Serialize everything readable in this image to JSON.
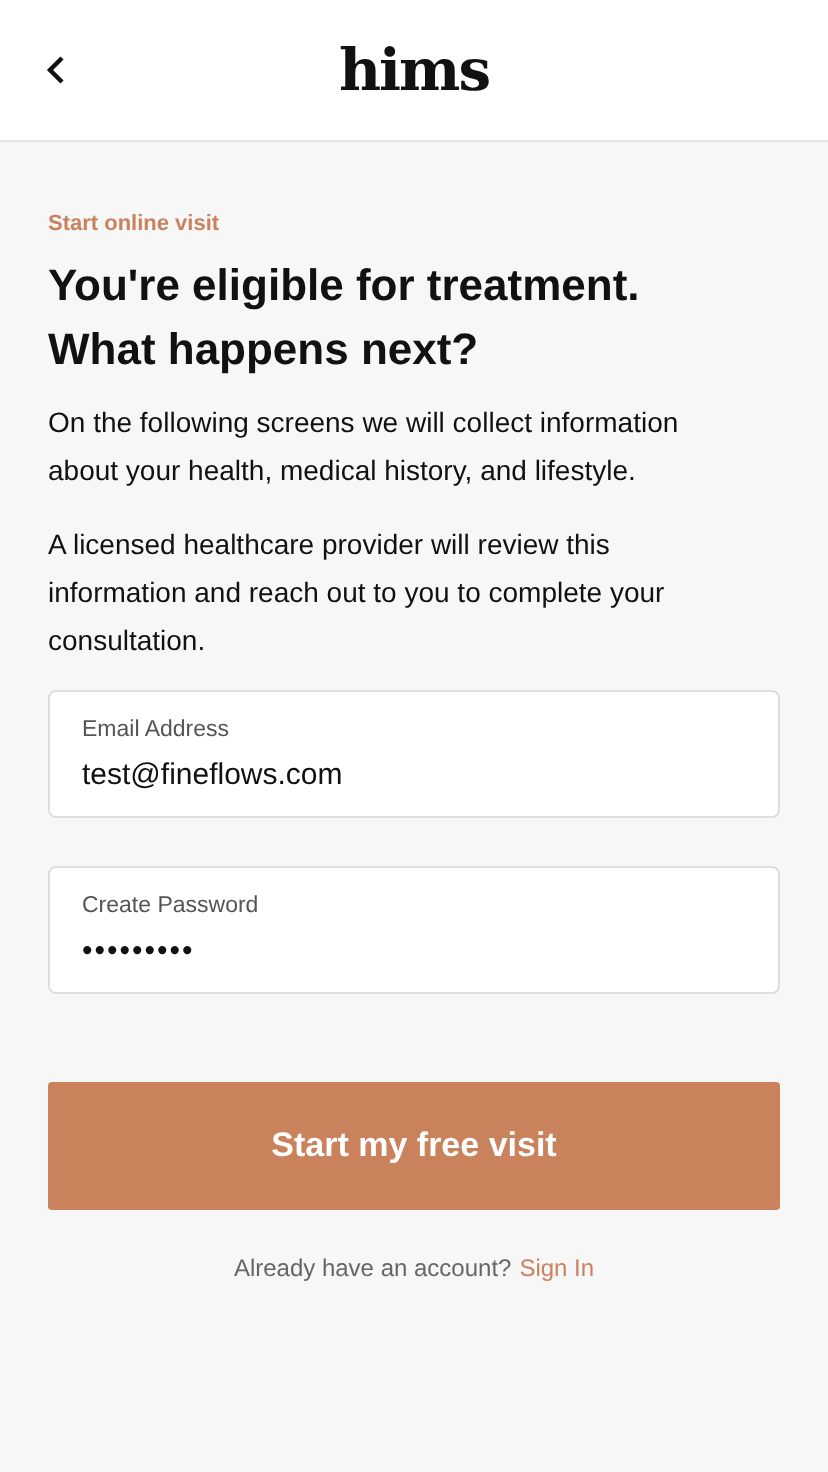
{
  "header": {
    "logo": "hims"
  },
  "eyebrow": "Start online visit",
  "heading": [
    "You're eligible for treatment.",
    "What happens next?"
  ],
  "paragraphs": [
    "On the following screens we will collect information about your health, medical history, and lifestyle.",
    "A licensed healthcare provider will review this information and reach out to you to complete your consultation."
  ],
  "fields": [
    {
      "label": "Email Address",
      "value": "test@fineflows.com",
      "kind": "text"
    },
    {
      "label": "Create Password",
      "value": "•••••••••",
      "kind": "password"
    }
  ],
  "submit_button": "Start my free visit",
  "footer": {
    "text": "Already have an account?",
    "link": "Sign In"
  }
}
